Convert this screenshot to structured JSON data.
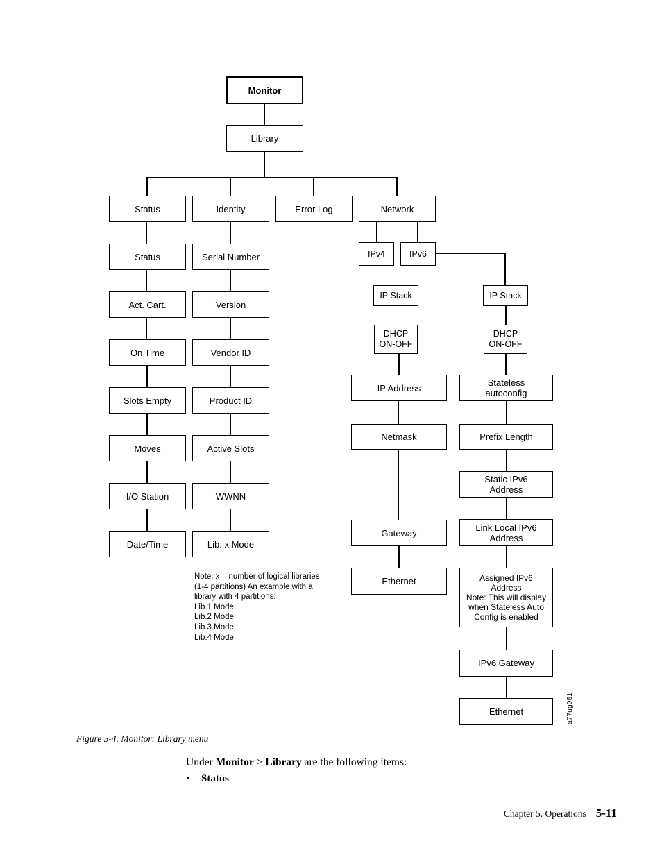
{
  "document": {
    "figure_caption": "Figure 5-4. Monitor: Library menu",
    "figure_id": "a77ug051",
    "body_intro_prefix": "Under ",
    "body_intro_bold1": "Monitor",
    "body_intro_mid": " > ",
    "body_intro_bold2": "Library",
    "body_intro_suffix": " are the following items:",
    "bullet_marker": "•",
    "bullet_item": "Status",
    "footer_chapter": "Chapter 5. Operations",
    "footer_page": "5-11"
  },
  "diagram": {
    "type": "tree-menu-hierarchy",
    "root": "Monitor",
    "level2": "Library",
    "note": "Note: x = number of logical libraries\n(1-4 partitions) An example with a\nlibrary with 4 partitions:\nLib.1 Mode\nLib.2 Mode\nLib.3 Mode\nLib.4 Mode",
    "nodes": {
      "monitor": "Monitor",
      "library": "Library",
      "status": "Status",
      "identity": "Identity",
      "error_log": "Error Log",
      "network": "Network",
      "status_status": "Status",
      "status_act_cart": "Act. Cart.",
      "status_on_time": "On Time",
      "status_slots_empty": "Slots Empty",
      "status_moves": "Moves",
      "status_io_station": "I/O Station",
      "status_date_time": "Date/Time",
      "identity_serial_number": "Serial Number",
      "identity_version": "Version",
      "identity_vendor_id": "Vendor ID",
      "identity_product_id": "Product ID",
      "identity_active_slots": "Active Slots",
      "identity_wwnn": "WWNN",
      "identity_lib_x_mode": "Lib. x Mode",
      "ipv4": "IPv4",
      "ipv6": "IPv6",
      "ipv4_ip_stack": "IP Stack",
      "ipv4_dhcp": "DHCP\nON-OFF",
      "ipv4_ip_address": "IP Address",
      "ipv4_netmask": "Netmask",
      "ipv4_gateway": "Gateway",
      "ipv4_ethernet": "Ethernet",
      "ipv6_ip_stack": "IP Stack",
      "ipv6_dhcp": "DHCP\nON-OFF",
      "ipv6_stateless": "Stateless\nautoconfig",
      "ipv6_prefix_length": "Prefix Length",
      "ipv6_static_address": "Static IPv6\nAddress",
      "ipv6_link_local": "Link Local IPv6\nAddress",
      "ipv6_assigned": "Assigned IPv6\nAddress\nNote:  This will display\nwhen Stateless Auto\nConfig is enabled",
      "ipv6_gateway": "IPv6 Gateway",
      "ipv6_ethernet": "Ethernet"
    }
  }
}
